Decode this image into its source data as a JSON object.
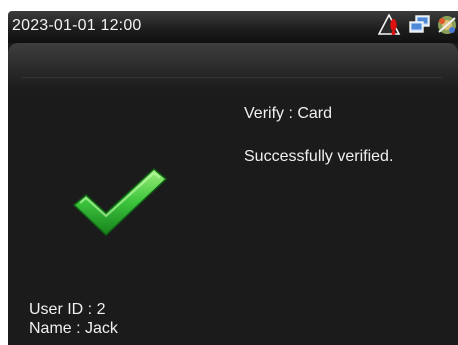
{
  "status_bar": {
    "datetime": "2023-01-01 12:00",
    "icons": [
      "warning-icon",
      "network-icon",
      "settings-icon"
    ]
  },
  "verification": {
    "method_line": "Verify : Card",
    "result_line": "Successfully verified.",
    "result_icon": "checkmark-icon"
  },
  "user": {
    "id_line": "User ID : 2",
    "name_line": "Name : Jack"
  },
  "colors": {
    "panel_bg": "#1b1b1b",
    "text": "#f0f0f0",
    "check_green": "#3cc43c",
    "warning_red": "#e01010"
  }
}
